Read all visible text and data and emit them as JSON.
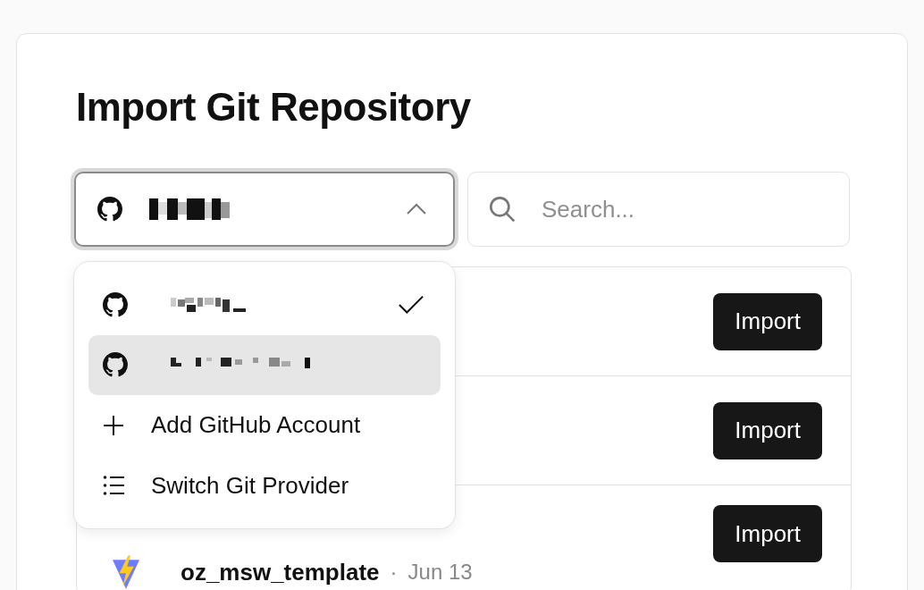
{
  "title": "Import Git Repository",
  "account_select": {
    "expanded": true
  },
  "search": {
    "placeholder": "Search..."
  },
  "repositories": [
    {
      "import_label": "Import"
    },
    {
      "import_label": "Import"
    },
    {
      "name": "oz_msw_template",
      "separator": "·",
      "date": "Jun 13",
      "import_label": "Import"
    }
  ],
  "account_menu": {
    "accounts": [
      {
        "selected": true,
        "highlighted": false
      },
      {
        "selected": false,
        "highlighted": true
      }
    ],
    "actions": [
      {
        "kind": "add",
        "label": "Add GitHub Account"
      },
      {
        "kind": "list",
        "label": "Switch Git Provider"
      }
    ]
  }
}
